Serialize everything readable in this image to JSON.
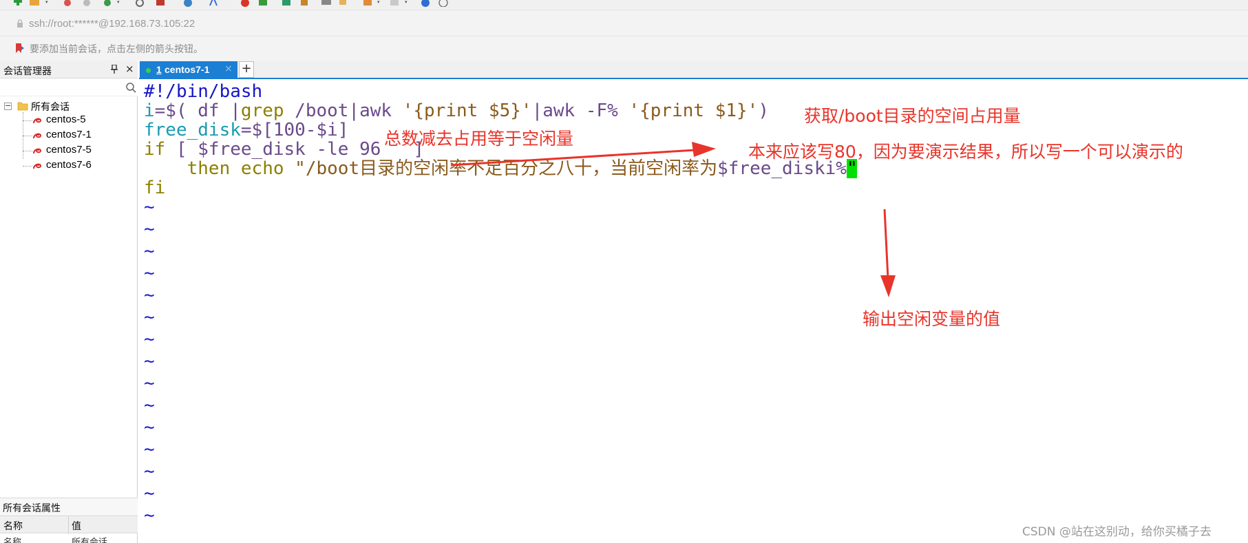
{
  "address_bar": {
    "text": "ssh://root:******@192.168.73.105:22"
  },
  "hint_bar": {
    "text": "要添加当前会话，点击左侧的箭头按钮。"
  },
  "session_manager": {
    "title": "会话管理器",
    "pin_glyph": "ᵽ",
    "close_glyph": "×",
    "search_placeholder": "",
    "tree": {
      "root": {
        "expander": "−",
        "label": "所有会话"
      },
      "sessions": [
        {
          "label": "centos-5"
        },
        {
          "label": "centos7-1"
        },
        {
          "label": "centos7-5"
        },
        {
          "label": "centos7-6"
        }
      ]
    },
    "properties": {
      "title": "所有会话属性",
      "columns": [
        "名称",
        "值"
      ],
      "rows": [
        {
          "name": "名称",
          "value": "所有会话"
        }
      ]
    }
  },
  "tabs": {
    "active": {
      "number": "1",
      "label": " centos7-1",
      "close": "×"
    },
    "add_label": "+"
  },
  "terminal": {
    "line1": "#!/bin/bash",
    "line2": {
      "var": "i",
      "rest": "=$( df |",
      "grep": "grep",
      "path": " /boot|",
      "awk1": "awk",
      "str1": " '{print $5}'",
      "pipe": "|",
      "awk2": "awk",
      "flag": " -F% ",
      "str2": "'{print $1}'",
      "close": ")"
    },
    "line3": {
      "var": "free_disk",
      "rest": "=$[100-$i]"
    },
    "line4": {
      "kw": "if",
      "rest": " [ $free_disk -le 96   ]"
    },
    "line5": {
      "indent": "    ",
      "kw1": "then",
      "kw2": "echo",
      "str": " \"/boot目录的空闲率不足百分之八十，当前空闲率为",
      "var": "$free_diski%",
      "cursor": "\""
    },
    "line6": "fi",
    "tilde": "~"
  },
  "annotations": {
    "a1": "获取/boot目录的空间占用量",
    "a2": "总数减去占用等于空闲量",
    "a3": "本来应该写80，因为要演示结果，所以写一个可以演示的",
    "a4": "输出空闲变量的值"
  },
  "watermark": "CSDN @站在这别动，给你买橘子去",
  "colors": {
    "accent": "#1b7fd4",
    "annotation": "#e8342a",
    "cursor": "#00e000"
  }
}
